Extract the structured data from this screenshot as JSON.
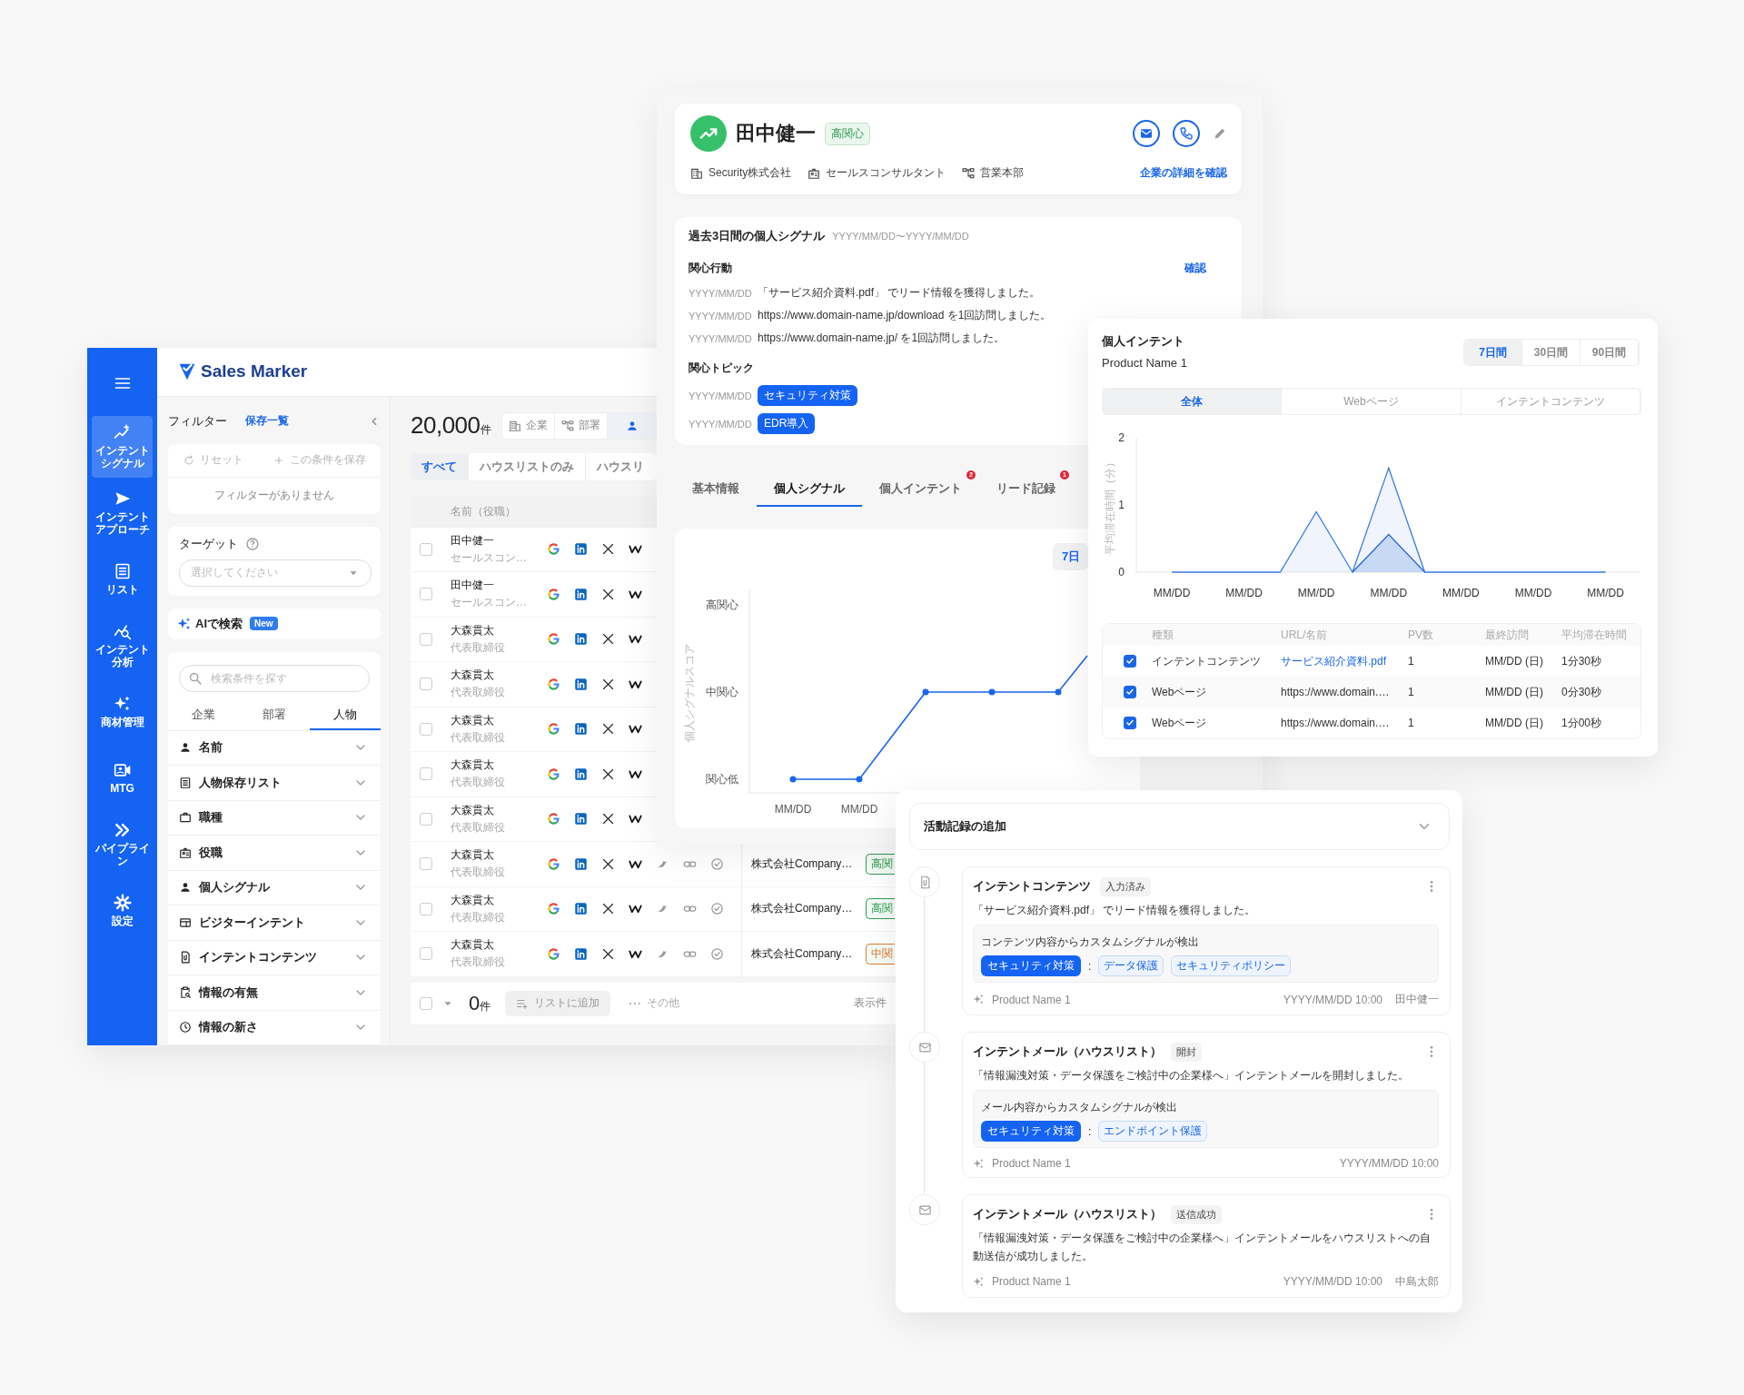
{
  "app": {
    "logo": "Sales Marker",
    "nav": [
      {
        "lines": [
          "インテント",
          "シグナル"
        ],
        "kind": "signal",
        "selected": true
      },
      {
        "lines": [
          "インテント",
          "アプローチ"
        ],
        "kind": "send",
        "selected": false
      },
      {
        "lines": [
          "リスト"
        ],
        "kind": "list",
        "selected": false
      },
      {
        "lines": [
          "インテント",
          "分析"
        ],
        "kind": "analysis",
        "selected": false
      },
      {
        "lines": [
          "商材管理"
        ],
        "kind": "sparkle",
        "selected": false
      },
      {
        "lines": [
          "MTG"
        ],
        "kind": "video",
        "selected": false
      },
      {
        "lines": [
          "パイプライ",
          "ン"
        ],
        "kind": "chevrons",
        "selected": false
      },
      {
        "lines": [
          "設定"
        ],
        "kind": "gear",
        "selected": false
      }
    ],
    "filter": {
      "title": "フィルター",
      "saved_link": "保存一覧",
      "reset": "リセット",
      "save": "この条件を保存",
      "empty": "フィルターがありません",
      "target_label": "ターゲット",
      "target_placeholder": "選択してください",
      "ai_search": "AIで検索",
      "new_badge": "New",
      "search_placeholder": "検索条件を探す",
      "tabs": [
        {
          "label": "企業",
          "selected": false
        },
        {
          "label": "部署",
          "selected": false
        },
        {
          "label": "人物",
          "selected": true
        }
      ],
      "categories": [
        {
          "label": "名前",
          "kind": "person"
        },
        {
          "label": "人物保存リスト",
          "kind": "list"
        },
        {
          "label": "職種",
          "kind": "briefcase"
        },
        {
          "label": "役職",
          "kind": "idcard"
        },
        {
          "label": "個人シグナル",
          "kind": "person"
        },
        {
          "label": "ビジターインテント",
          "kind": "window"
        },
        {
          "label": "インテントコンテンツ",
          "kind": "doc"
        },
        {
          "label": "情報の有無",
          "kind": "clipboard"
        },
        {
          "label": "情報の新さ",
          "kind": "clock"
        }
      ]
    },
    "table": {
      "count": "20,000",
      "unit": "件",
      "entity_tabs": [
        {
          "label": "企業",
          "kind": "building",
          "selected": false
        },
        {
          "label": "部署",
          "kind": "org",
          "selected": false
        },
        {
          "kind": "person",
          "selected": true
        }
      ],
      "list_tabs": [
        {
          "label": "すべて",
          "selected": true
        },
        {
          "label": "ハウスリストのみ",
          "selected": false
        },
        {
          "label": "ハウスリ",
          "selected": false
        }
      ],
      "column": "名前（役職）",
      "rows": [
        {
          "checked": false,
          "name": "田中健一",
          "role": "セールスコン…"
        },
        {
          "checked": false,
          "name": "田中健一",
          "role": "セールスコン…"
        },
        {
          "checked": false,
          "name": "大森貫太",
          "role": "代表取締役"
        },
        {
          "checked": false,
          "name": "大森貫太",
          "role": "代表取締役"
        },
        {
          "checked": false,
          "name": "大森貫太",
          "role": "代表取締役"
        },
        {
          "checked": false,
          "name": "大森貫太",
          "role": "代表取締役"
        },
        {
          "checked": false,
          "name": "大森貫太",
          "role": "代表取締役"
        },
        {
          "checked": false,
          "name": "大森貫太",
          "role": "代表取締役",
          "company": "株式会社Company…",
          "tag": "高関",
          "color": "#2f9e52"
        },
        {
          "checked": false,
          "name": "大森貫太",
          "role": "代表取締役",
          "company": "株式会社Company…",
          "tag": "高関",
          "color": "#2f9e52"
        },
        {
          "checked": false,
          "name": "大森貫太",
          "role": "代表取締役",
          "company": "株式会社Company…",
          "tag": "中関",
          "color": "#e07a30"
        }
      ],
      "footer": {
        "checked": false,
        "count": "0",
        "unit": "件",
        "add": "リストに追加",
        "other": "その他",
        "per_page": "表示件"
      }
    }
  },
  "profile": {
    "name": "田中健一",
    "interest": "高関心",
    "company": "Security株式会社",
    "job": "セールスコンサルタント",
    "department": "営業本部",
    "detail_link": "企業の詳細を確認"
  },
  "signals": {
    "title": "過去3日間の個人シグナル",
    "range": "YYYY/MM/DD〜YYYY/MM/DD",
    "actions_title": "関心行動",
    "confirm": "確認",
    "actions": [
      {
        "date": "YYYY/MM/DD",
        "text": "「サービス紹介資料.pdf」 でリード情報を獲得しました。"
      },
      {
        "date": "YYYY/MM/DD",
        "text": "https://www.domain-name.jp/download を1回訪問しました。"
      },
      {
        "date": "YYYY/MM/DD",
        "text": "https://www.domain-name.jp/ を1回訪問しました。"
      }
    ],
    "topics_title": "関心トピック",
    "topics": [
      {
        "date": "YYYY/MM/DD",
        "tag": "セキュリティ対策"
      },
      {
        "date": "YYYY/MM/DD",
        "tag": "EDR導入"
      }
    ]
  },
  "detail_tabs": [
    {
      "label": "基本情報",
      "selected": false
    },
    {
      "label": "個人シグナル",
      "selected": true
    },
    {
      "label": "個人インテント",
      "selected": false,
      "badge": "2"
    },
    {
      "label": "リード記録",
      "selected": false,
      "badge": "1"
    }
  ],
  "signal_chart": {
    "period": "7日",
    "ylabel": "個人シグナルスコア",
    "y_labels": [
      "高関心",
      "中関心",
      "関心低"
    ],
    "x_labels": [
      "MM/DD",
      "MM/DD"
    ]
  },
  "intent": {
    "title": "個人インテント",
    "product": "Product Name 1",
    "periods": [
      {
        "label": "7日間",
        "selected": true
      },
      {
        "label": "30日間",
        "selected": false
      },
      {
        "label": "90日間",
        "selected": false
      }
    ],
    "filters": [
      {
        "label": "全体",
        "selected": true
      },
      {
        "label": "Webページ",
        "selected": false
      },
      {
        "label": "インテントコンテンツ",
        "selected": false
      }
    ],
    "chart_data": {
      "type": "area",
      "ylabel": "平均滞在時間（分）",
      "categories": [
        "MM/DD",
        null,
        "MM/DD",
        null,
        "MM/DD",
        null,
        "MM/DD",
        null,
        "MM/DD",
        null,
        "MM/DD",
        null,
        "MM/DD"
      ],
      "ylim": [
        0,
        2
      ],
      "yticks": [
        0,
        1,
        2
      ],
      "series": [
        {
          "color": "#3b7de0",
          "values": [
            0,
            0,
            0,
            0,
            0.9,
            0,
            1.55,
            0,
            0,
            0,
            0,
            0,
            0
          ]
        },
        {
          "color": "#2a6ad6",
          "values": [
            null,
            null,
            null,
            null,
            null,
            0,
            0.56,
            0,
            null,
            null,
            null,
            null,
            null
          ]
        }
      ]
    },
    "table": {
      "columns": [
        "種類",
        "URL/名前",
        "PV数",
        "最終訪問",
        "平均滞在時間"
      ],
      "rows": [
        {
          "checked": true,
          "type": "インテントコンテンツ",
          "name": "サービス紹介資料.pdf",
          "link": true,
          "pv": "1",
          "last": "MM/DD (日)",
          "avg": "1分30秒"
        },
        {
          "checked": true,
          "type": "Webページ",
          "name": "https://www.domain.…",
          "link": false,
          "pv": "1",
          "last": "MM/DD (日)",
          "avg": "0分30秒"
        },
        {
          "checked": true,
          "type": "Webページ",
          "name": "https://www.domain.…",
          "link": false,
          "pv": "1",
          "last": "MM/DD (日)",
          "avg": "1分00秒"
        }
      ]
    }
  },
  "activity": {
    "title": "活動記録の追加",
    "entries": [
      {
        "kind": "doc",
        "title": "インテントコンテンツ",
        "status": "入力済み",
        "text": "「サービス紹介資料.pdf」 でリード情報を獲得しました。",
        "detect": {
          "label": "コンテンツ内容からカスタムシグナルが検出",
          "main_tag": "セキュリティ対策",
          "separator": ":",
          "sub_tags": [
            "データ保護",
            "セキュリティポリシー"
          ]
        },
        "product": "Product Name 1",
        "time": "YYYY/MM/DD 10:00",
        "user": "田中健一"
      },
      {
        "kind": "mail",
        "title": "インテントメール（ハウスリスト）",
        "status": "開封",
        "text": "「情報漏洩対策・データ保護をご検討中の企業様へ」インテントメールを開封しました。",
        "detect": {
          "label": "メール内容からカスタムシグナルが検出",
          "main_tag": "セキュリティ対策",
          "separator": ":",
          "sub_tags": [
            "エンドポイント保護"
          ]
        },
        "product": "Product Name 1",
        "time": "YYYY/MM/DD 10:00"
      },
      {
        "kind": "mail",
        "title": "インテントメール（ハウスリスト）",
        "status": "送信成功",
        "text": "「情報漏洩対策・データ保護をご検討中の企業様へ」インテントメールをハウスリストへの自動送信が成功しました。",
        "product": "Product Name 1",
        "time": "YYYY/MM/DD 10:00",
        "user": "中島太郎"
      }
    ]
  }
}
